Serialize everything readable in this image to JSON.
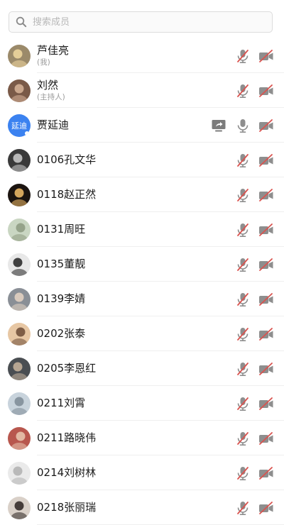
{
  "search": {
    "placeholder": "搜索成员"
  },
  "members": [
    {
      "name": "芦佳亮",
      "sub": "(我)",
      "avatar": {
        "kind": "photo",
        "bg": "#9b8a6a",
        "fg": "#f2d9a0"
      },
      "sharing": false,
      "mic": "muted",
      "cam": "off"
    },
    {
      "name": "刘然",
      "sub": "(主持人)",
      "avatar": {
        "kind": "photo",
        "bg": "#7a5a48",
        "fg": "#d8b59a"
      },
      "sharing": false,
      "mic": "muted",
      "cam": "off"
    },
    {
      "name": "贾延迪",
      "sub": "",
      "avatar": {
        "kind": "text",
        "text": "延迪",
        "bg": "#3b82f0"
      },
      "sharing": true,
      "mic": "on",
      "cam": "off"
    },
    {
      "name": "0106孔文华",
      "sub": "",
      "avatar": {
        "kind": "photo",
        "bg": "#3a3a3a",
        "fg": "#cfcfcf"
      },
      "sharing": false,
      "mic": "muted",
      "cam": "off"
    },
    {
      "name": "0118赵正然",
      "sub": "",
      "avatar": {
        "kind": "photo",
        "bg": "#1b1410",
        "fg": "#f5c06a"
      },
      "sharing": false,
      "mic": "muted",
      "cam": "off"
    },
    {
      "name": "0131周旺",
      "sub": "",
      "avatar": {
        "kind": "photo",
        "bg": "#c9d6c2",
        "fg": "#8c9a80"
      },
      "sharing": false,
      "mic": "muted",
      "cam": "off"
    },
    {
      "name": "0135董靓",
      "sub": "",
      "avatar": {
        "kind": "photo",
        "bg": "#e8e8e8",
        "fg": "#222222"
      },
      "sharing": false,
      "mic": "muted",
      "cam": "off"
    },
    {
      "name": "0139李婧",
      "sub": "",
      "avatar": {
        "kind": "photo",
        "bg": "#8a8f96",
        "fg": "#e6d5c4"
      },
      "sharing": false,
      "mic": "muted",
      "cam": "off"
    },
    {
      "name": "0202张泰",
      "sub": "",
      "avatar": {
        "kind": "photo",
        "bg": "#e7c7a4",
        "fg": "#6b4a36"
      },
      "sharing": false,
      "mic": "muted",
      "cam": "off"
    },
    {
      "name": "0205李恩红",
      "sub": "",
      "avatar": {
        "kind": "photo",
        "bg": "#4a4e52",
        "fg": "#c9b59e"
      },
      "sharing": false,
      "mic": "muted",
      "cam": "off"
    },
    {
      "name": "0211刘霄",
      "sub": "",
      "avatar": {
        "kind": "photo",
        "bg": "#c8d3dc",
        "fg": "#7d8a95"
      },
      "sharing": false,
      "mic": "muted",
      "cam": "off"
    },
    {
      "name": "0211路晓伟",
      "sub": "",
      "avatar": {
        "kind": "photo",
        "bg": "#b8574e",
        "fg": "#e9c9b3"
      },
      "sharing": false,
      "mic": "muted",
      "cam": "off"
    },
    {
      "name": "0214刘树林",
      "sub": "",
      "avatar": {
        "kind": "photo",
        "bg": "#eaeaea",
        "fg": "#b0b0b0"
      },
      "sharing": false,
      "mic": "muted",
      "cam": "off"
    },
    {
      "name": "0218张丽瑞",
      "sub": "",
      "avatar": {
        "kind": "photo",
        "bg": "#d9d0c8",
        "fg": "#2a2220"
      },
      "sharing": false,
      "mic": "muted",
      "cam": "off"
    }
  ],
  "colors": {
    "muted": "#d9534f",
    "icon": "#8e8e8e",
    "share": "#7c7c7c"
  }
}
